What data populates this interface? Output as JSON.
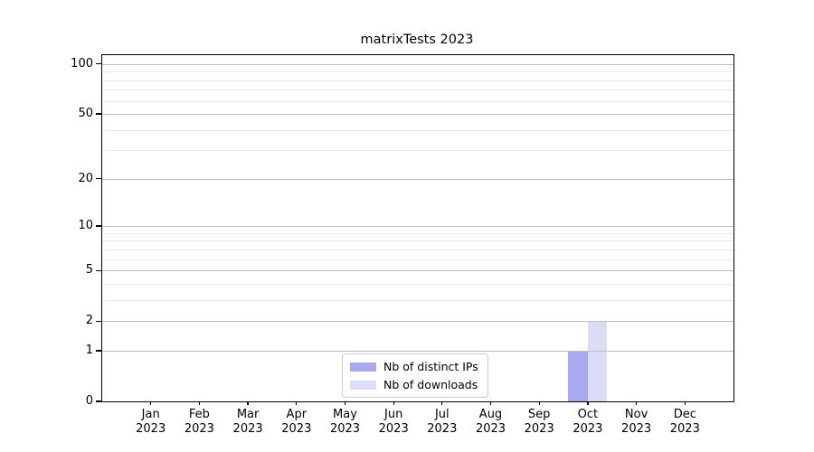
{
  "title": "matrixTests 2023",
  "chart_data": {
    "type": "bar",
    "title": "matrixTests 2023",
    "xlabel": "",
    "ylabel": "",
    "yscale": "log1p",
    "ylim": [
      0,
      113
    ],
    "grid": "on",
    "legend_position": "lower-center",
    "categories": [
      "Jan 2023",
      "Feb 2023",
      "Mar 2023",
      "Apr 2023",
      "May 2023",
      "Jun 2023",
      "Jul 2023",
      "Aug 2023",
      "Sep 2023",
      "Oct 2023",
      "Nov 2023",
      "Dec 2023"
    ],
    "y_major_ticks": [
      0,
      1,
      2,
      5,
      10,
      20,
      50,
      100
    ],
    "y_minor_gridlines": [
      3,
      4,
      6,
      7,
      8,
      9,
      30,
      40,
      60,
      70,
      80,
      90
    ],
    "series": [
      {
        "name": "Nb of distinct IPs",
        "color": "#a9a9f0",
        "values": [
          0,
          0,
          0,
          0,
          0,
          0,
          0,
          0,
          0,
          1,
          0,
          0
        ]
      },
      {
        "name": "Nb of downloads",
        "color": "#dcdcf7",
        "values": [
          0,
          0,
          0,
          0,
          0,
          0,
          0,
          0,
          0,
          2,
          0,
          0
        ]
      }
    ],
    "colors": {
      "axis": "#000000",
      "grid_major": "#bdbdbd",
      "grid_minor": "#e9e9e9"
    }
  }
}
